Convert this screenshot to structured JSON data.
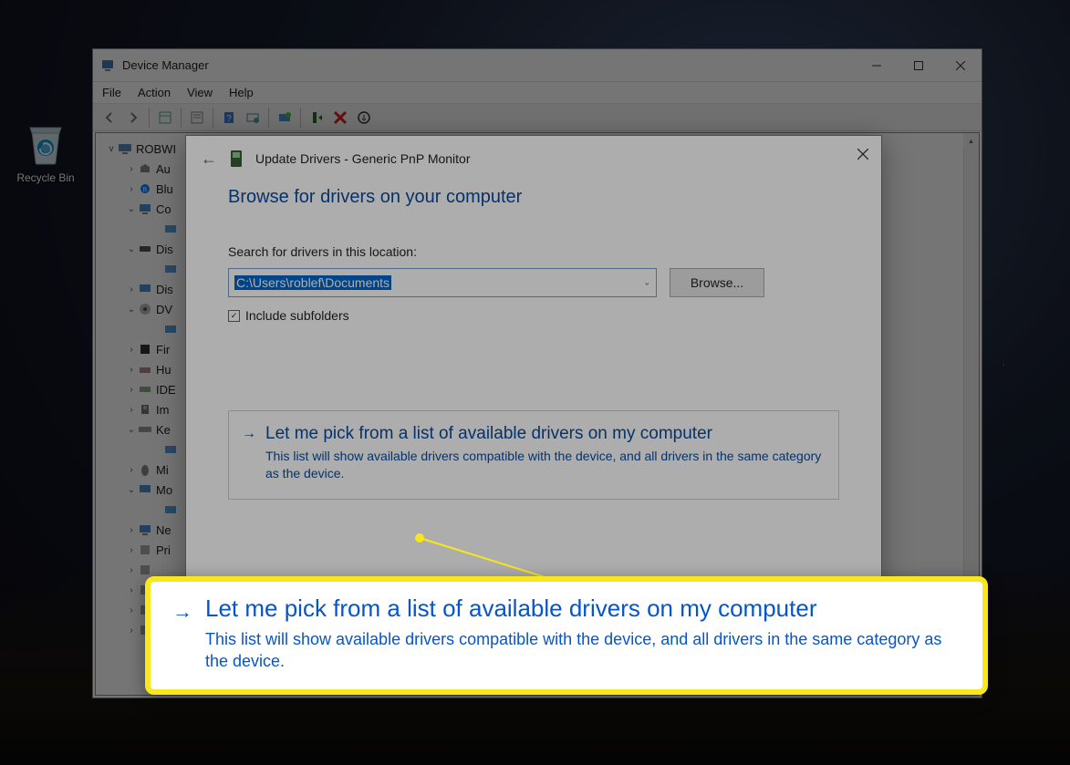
{
  "desktop": {
    "recycle_bin": "Recycle Bin"
  },
  "device_manager": {
    "title": "Device Manager",
    "menu": {
      "file": "File",
      "action": "Action",
      "view": "View",
      "help": "Help"
    },
    "tree": {
      "root": "ROBWI",
      "items": [
        {
          "label": "Au",
          "expand": ">"
        },
        {
          "label": "Blu",
          "expand": ">"
        },
        {
          "label": "Co",
          "expand": "v",
          "child": ""
        },
        {
          "label": "Dis",
          "expand": "v",
          "child": ""
        },
        {
          "label": "Dis",
          "expand": ">"
        },
        {
          "label": "DV",
          "expand": "v",
          "child": ""
        },
        {
          "label": "Fir",
          "expand": ">"
        },
        {
          "label": "Hu",
          "expand": ">"
        },
        {
          "label": "IDE",
          "expand": ">"
        },
        {
          "label": "Im",
          "expand": ">"
        },
        {
          "label": "Ke",
          "expand": "v",
          "child": ""
        },
        {
          "label": "Mi",
          "expand": ">"
        },
        {
          "label": "Mo",
          "expand": "v",
          "child": ""
        },
        {
          "label": "Ne",
          "expand": ">"
        },
        {
          "label": "Pri",
          "expand": ">"
        },
        {
          "label": "",
          "expand": ">"
        },
        {
          "label": "",
          "expand": ">"
        },
        {
          "label": "",
          "expand": ">"
        },
        {
          "label": "",
          "expand": ">"
        }
      ]
    }
  },
  "dialog": {
    "title": "Update Drivers - Generic PnP Monitor",
    "heading": "Browse for drivers on your computer",
    "search_label": "Search for drivers in this location:",
    "path_value": "C:\\Users\\roblef\\Documents",
    "browse_btn": "Browse...",
    "include_subfolders": "Include subfolders",
    "option_title": "Let me pick from a list of available drivers on my computer",
    "option_desc": "This list will show available drivers compatible with the device, and all drivers in the same category as the device."
  },
  "callout": {
    "title": "Let me pick from a list of available drivers on my computer",
    "desc": "This list will show available drivers compatible with the device, and all drivers in the same category as the device."
  }
}
